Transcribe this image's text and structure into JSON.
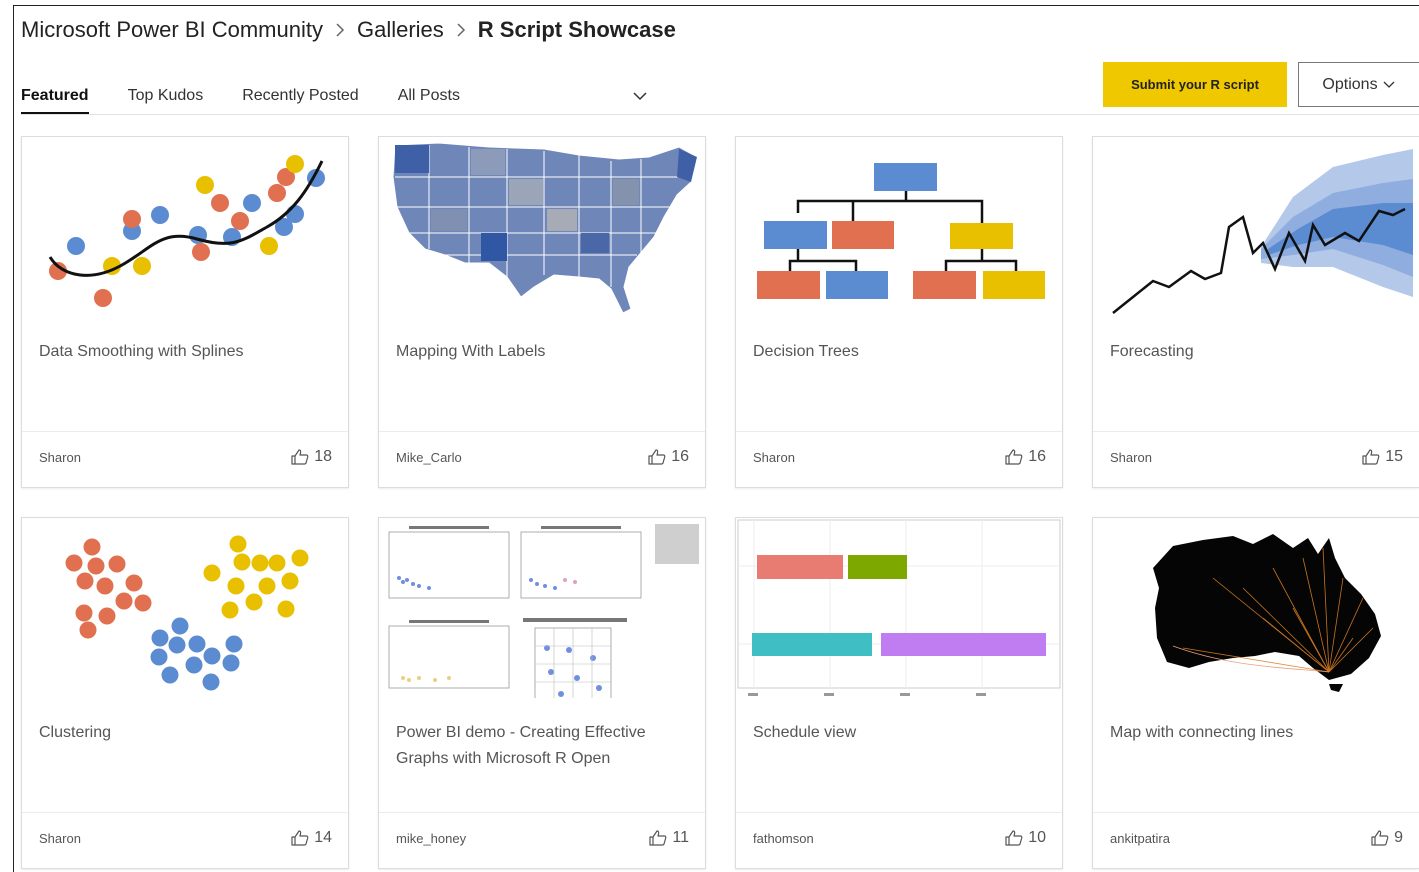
{
  "breadcrumb": [
    "Microsoft Power BI Community",
    "Galleries",
    "R Script Showcase"
  ],
  "tabs": [
    "Featured",
    "Top Kudos",
    "Recently Posted",
    "All Posts"
  ],
  "active_tab": "Featured",
  "actions": {
    "submit_label": "Submit your R script",
    "options_label": "Options"
  },
  "cards": [
    {
      "title": "Data Smoothing with Splines",
      "author": "Sharon",
      "kudos": "18"
    },
    {
      "title": "Mapping With Labels",
      "author": "Mike_Carlo",
      "kudos": "16"
    },
    {
      "title": "Decision Trees",
      "author": "Sharon",
      "kudos": "16"
    },
    {
      "title": "Forecasting",
      "author": "Sharon",
      "kudos": "15"
    },
    {
      "title": "Clustering",
      "author": "Sharon",
      "kudos": "14"
    },
    {
      "title": "Power BI demo - Creating Effective Graphs with Microsoft R Open",
      "author": "mike_honey",
      "kudos": "11"
    },
    {
      "title": "Schedule view",
      "author": "fathomson",
      "kudos": "10"
    },
    {
      "title": "Map with connecting lines",
      "author": "ankitpatira",
      "kudos": "9"
    }
  ],
  "colors": {
    "accent": "#f0c800",
    "blue": "#5b8bd0",
    "orange": "#e07050",
    "yellow": "#e8c000"
  },
  "icons": {
    "kudos": "thumbs-up-icon",
    "breadcrumb_sep": "chevron-right-icon",
    "dropdown": "chevron-down-icon"
  }
}
